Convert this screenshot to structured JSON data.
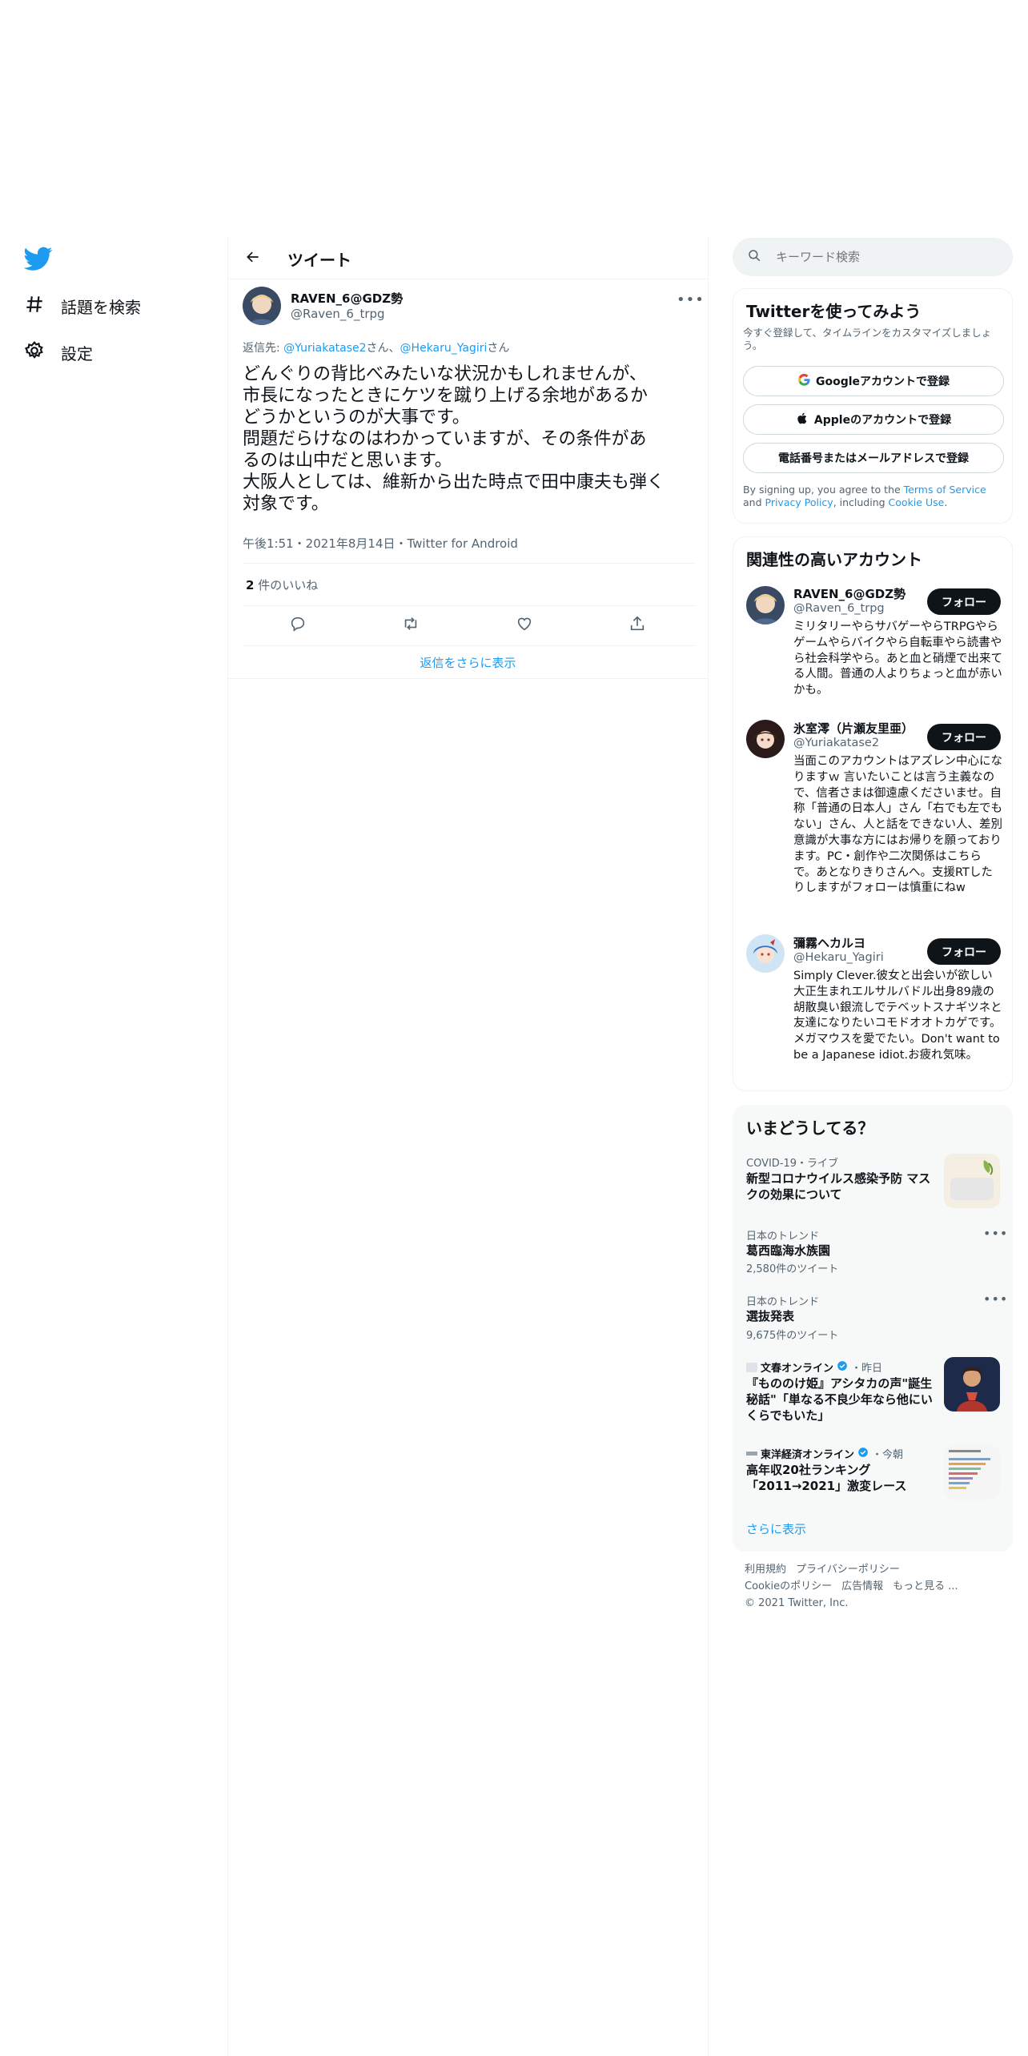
{
  "colors": {
    "accent": "#1d9bf0",
    "text": "#0f1419",
    "muted": "#536471",
    "border": "#eff3f4"
  },
  "nav": {
    "logo": "twitter-bird-icon",
    "items": [
      {
        "label": "話題を検索",
        "icon": "hashtag-icon"
      },
      {
        "label": "設定",
        "icon": "gear-icon"
      }
    ]
  },
  "header": {
    "title": "ツイート"
  },
  "tweet": {
    "author_name": "RAVEN_6@GDZ勢",
    "author_handle": "@Raven_6_trpg",
    "reply_prefix": "返信先: ",
    "reply_to_1": "@Yuriakatase2",
    "reply_sep": "さん、",
    "reply_to_2": "@Hekaru_Yagiri",
    "reply_suffix": "さん",
    "body": "どんぐりの背比べみたいな状況かもしれませんが、\n市長になったときにケツを蹴り上げる余地があるか\nどうかというのが大事です。\n問題だらけなのはわかっていますが、その条件があ\nるのは山中だと思います。\n大阪人としては、維新から出た時点で田中康夫も弾く\n対象です。",
    "meta": "午後1:51・2021年8月14日・Twitter for Android",
    "like_count": "2",
    "like_label": " 件のいいね",
    "more_replies": "返信をさらに表示"
  },
  "search": {
    "placeholder": "キーワード検索"
  },
  "signup": {
    "title": "Twitterを使ってみよう",
    "subtitle": "今すぐ登録して、タイムラインをカスタマイズしましょう。",
    "google": "Googleアカウントで登録",
    "apple": "Appleのアカウントで登録",
    "phone": "電話番号またはメールアドレスで登録",
    "terms_prefix": "By signing up, you agree to the ",
    "terms_link": "Terms of Service",
    "terms_and": " and ",
    "privacy_link": "Privacy Policy",
    "terms_including": ", including ",
    "cookie_link": "Cookie Use",
    "terms_end": "."
  },
  "related": {
    "title": "関連性の高いアカウント",
    "follow": "フォロー",
    "accounts": [
      {
        "name": "RAVEN_6@GDZ勢",
        "handle": "@Raven_6_trpg",
        "bio": "ミリタリーやらサバゲーやらTRPGやらゲームやらバイクやら自転車やら読書やら社会科学やら。あと血と硝煙で出来てる人間。普通の人よりちょっと血が赤いかも。"
      },
      {
        "name": "氷室澪（片瀬友里亜）",
        "handle": "@Yuriakatase2",
        "bio": "当面このアカウントはアズレン中心になりますｗ 言いたいことは言う主義なので、信者さまは御遠慮くださいませ。自称「普通の日本人」さん「右でも左でもない」さん、人と話をできない人、差別意識が大事な方にはお帰りを願っております。PC・創作や二次関係はこちらで。あとなりきりさんへ。支援RTしたりしますがフォローは慎重にねw"
      },
      {
        "name": "彌霧ヘカルヨ",
        "handle": "@Hekaru_Yagiri",
        "bio": "Simply Clever.彼女と出会いが欲しい大正生まれエルサルバドル出身89歳の胡散臭い銀流しでテベットスナギツネと友達になりたいコモドオオトカゲです。メガマウスを愛でたい。Don't want to be a Japanese idiot.お疲れ気味。"
      }
    ]
  },
  "trends": {
    "title": "いまどうしてる？",
    "items": [
      {
        "category": "COVID-19・ライブ",
        "title": "新型コロナウイルス感染予防 マスクの効果について",
        "thumb": "mask-photo"
      },
      {
        "category": "日本のトレンド",
        "title": "葛西臨海水族園",
        "count": "2,580件のツイート"
      },
      {
        "category": "日本のトレンド",
        "title": "選抜発表",
        "count": "9,675件のツイート"
      },
      {
        "category": "文春オンライン",
        "category_suffix": "・昨日",
        "title": "『もののけ姫』アシタカの声\"誕生秘話\"「単なる不良少年なら他にいくらでもいた」",
        "thumb": "anime-character-photo"
      },
      {
        "category": "東洋経済オンライン",
        "category_suffix": "・今朝",
        "title": "高年収20社ランキング「2011→2021」激変レース",
        "thumb": "ranking-chart-photo"
      }
    ],
    "show_more": "さらに表示"
  },
  "footer": {
    "links_row1": [
      "利用規約",
      "プライバシーポリシー"
    ],
    "links_row2": [
      "Cookieのポリシー",
      "広告情報",
      "もっと見る ..."
    ],
    "copyright": "© 2021 Twitter, Inc."
  }
}
